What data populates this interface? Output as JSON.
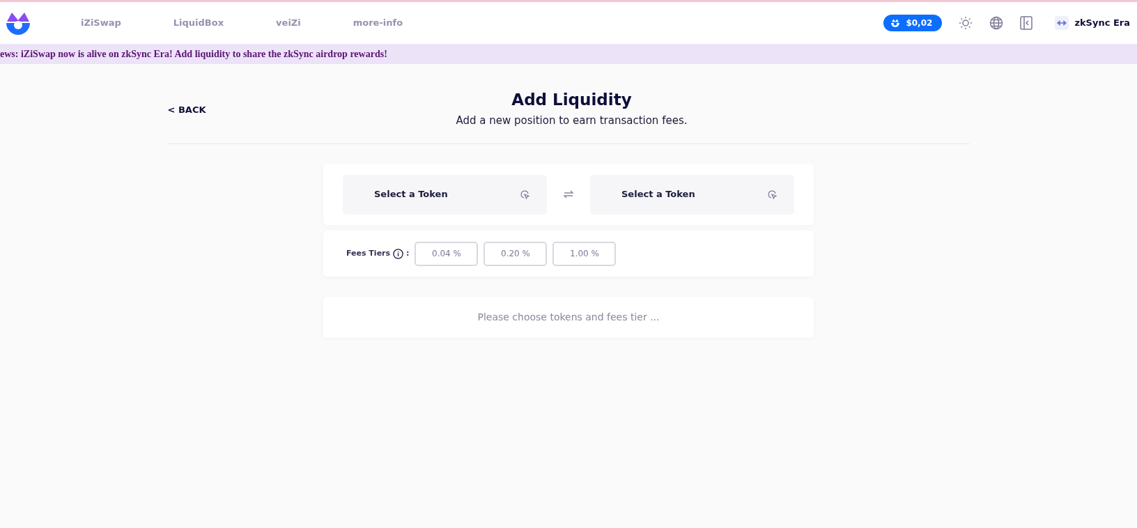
{
  "nav": {
    "items": [
      {
        "label": "iZiSwap"
      },
      {
        "label": "LiquidBox"
      },
      {
        "label": "veiZi"
      },
      {
        "label": "more-info"
      }
    ],
    "price": "$0,02",
    "network": "zkSync Era"
  },
  "banner": "ews: iZiSwap now is alive on zkSync Era! Add liquidity to share the zkSync airdrop rewards!",
  "back": "< BACK",
  "title": "Add Liquidity",
  "subtitle": "Add a new position to earn transaction fees.",
  "tokens": [
    {
      "label": "Select a Token"
    },
    {
      "label": "Select a Token"
    }
  ],
  "fees": {
    "label": "Fees Tiers",
    "colon": ":",
    "tiers": [
      {
        "label": "0.04 %",
        "selected": false
      },
      {
        "label": "0.20 %",
        "selected": false
      },
      {
        "label": "1.00 %",
        "selected": false
      }
    ]
  },
  "message": "Please choose tokens and fees tier ..."
}
